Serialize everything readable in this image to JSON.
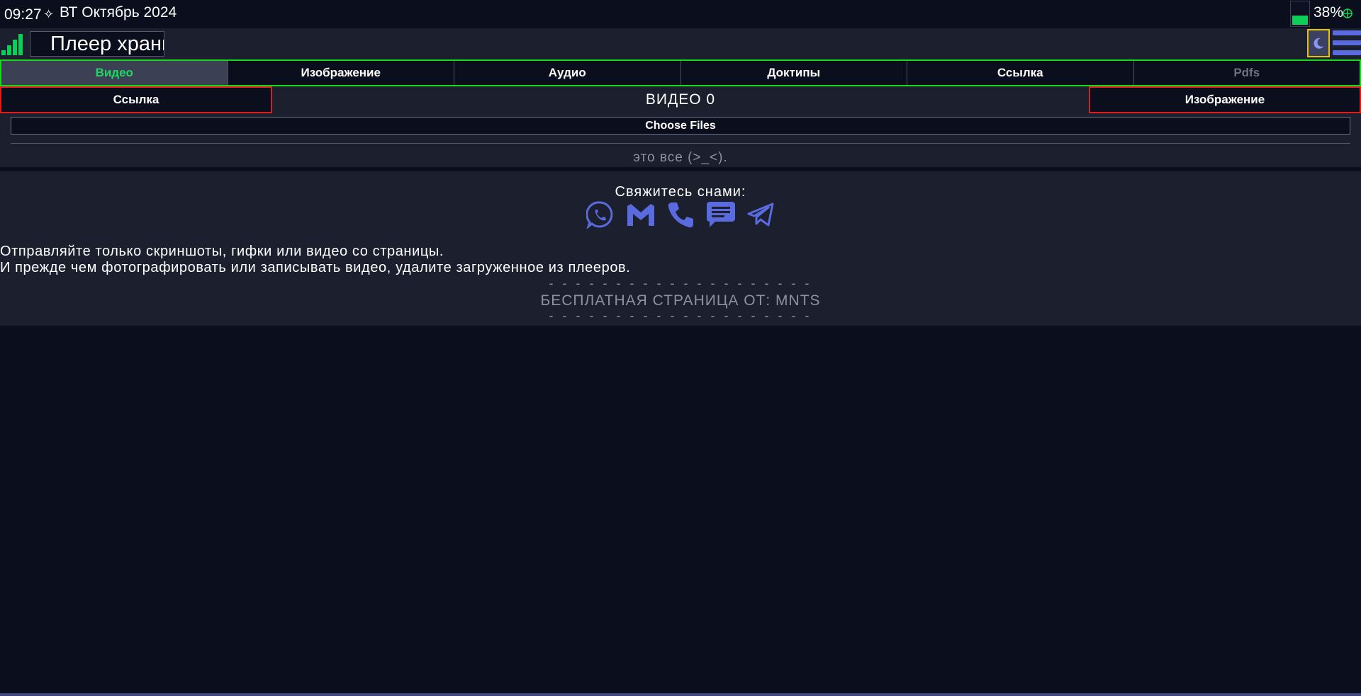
{
  "status_bar": {
    "time": "09:27",
    "spark": "✧",
    "date": "ВТ Октябрь 2024",
    "battery_percent": "38%",
    "battery_level": 0.38
  },
  "header": {
    "title_value": "Плеер хранилища",
    "signal_level": 4
  },
  "tabs": [
    {
      "label": "Видео",
      "active": true
    },
    {
      "label": "Изображение",
      "active": false
    },
    {
      "label": "Аудио",
      "active": false
    },
    {
      "label": "Доктипы",
      "active": false
    },
    {
      "label": "Ссылка",
      "active": false
    },
    {
      "label": "Pdfs",
      "active": false,
      "dim": true
    }
  ],
  "subnav": {
    "left_label": "Ссылка",
    "title": "ВИДЕО 0",
    "right_label": "Изображение"
  },
  "main": {
    "file_button_label": "Choose Files",
    "end_text": "это все (>_<)."
  },
  "footer": {
    "contact_title": "Свяжитесь снами:",
    "contact_icons": [
      "whatsapp-icon",
      "gmail-icon",
      "phone-icon",
      "message-icon",
      "telegram-icon"
    ],
    "notice_line1": "Отправляйте только скриншоты, гифки или видео со страницы.",
    "notice_line2": "И прежде чем фотографировать или записывать видео, удалите загруженное из плееров.",
    "dashes": "- - - - - - - - - - - - - - - - - - - -",
    "brand": "БЕСПЛАТНАЯ СТРАНИЦА ОТ: MNTS"
  },
  "colors": {
    "background": "#0b0e1d",
    "panel": "#1c1f2e",
    "accent_green": "#1ed760",
    "accent_red": "#e31b1b",
    "accent_blue": "#5a6be0",
    "theme_border": "#e6c200"
  }
}
